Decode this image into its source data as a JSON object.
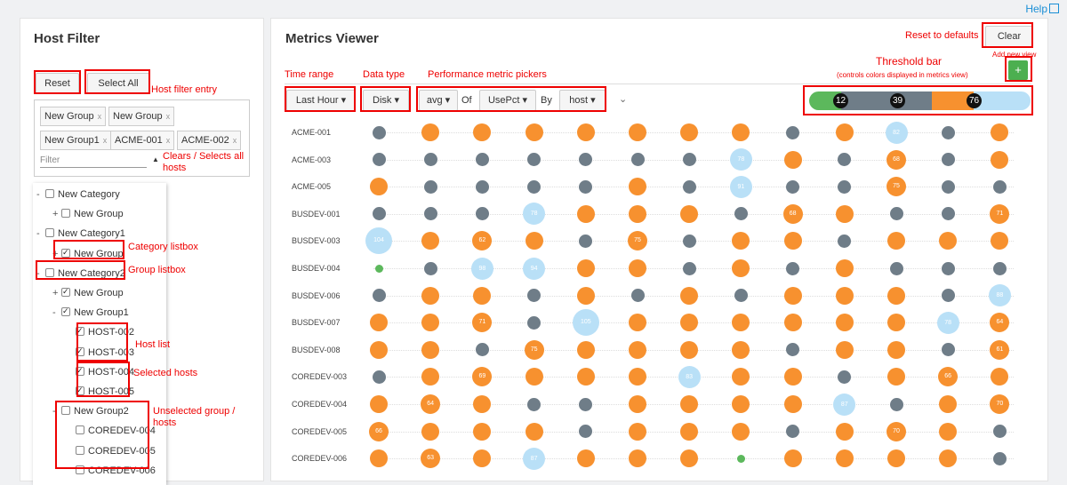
{
  "help_label": "Help",
  "host_filter": {
    "title": "Host Filter",
    "reset_label": "Reset",
    "select_all_label": "Select All",
    "tags": [
      "New Group",
      "New Group",
      "New Group1",
      "ACME-001",
      "ACME-002"
    ],
    "filter_placeholder": "Filter",
    "tree": [
      {
        "label": "New Category",
        "pm": "-",
        "checked": false
      },
      {
        "label": "New Group",
        "pm": "+",
        "checked": false
      },
      {
        "label": "New Category1",
        "pm": "-",
        "checked": false
      },
      {
        "label": "New Group",
        "pm": "+",
        "checked": true
      },
      {
        "label": "New Category2",
        "pm": "-",
        "checked": false
      },
      {
        "label": "New Group",
        "pm": "+",
        "checked": true
      },
      {
        "label": "New Group1",
        "pm": "-",
        "checked": true
      },
      {
        "label": "HOST-002",
        "pm": "",
        "checked": true
      },
      {
        "label": "HOST-003",
        "pm": "",
        "checked": true
      },
      {
        "label": "HOST-004",
        "pm": "",
        "checked": true
      },
      {
        "label": "HOST-005",
        "pm": "",
        "checked": true
      },
      {
        "label": "New Group2",
        "pm": "-",
        "checked": false
      },
      {
        "label": "COREDEV-004",
        "pm": "",
        "checked": false
      },
      {
        "label": "COREDEV-005",
        "pm": "",
        "checked": false
      },
      {
        "label": "COREDEV-006",
        "pm": "",
        "checked": false
      }
    ]
  },
  "metrics_viewer": {
    "title": "Metrics Viewer",
    "time_range": "Last Hour",
    "data_type": "Disk",
    "aggregate": "avg",
    "of_label": "Of",
    "metric": "UsePct",
    "by_label": "By",
    "group_by": "host",
    "clear_label": "Clear",
    "add_label": "+",
    "threshold_values": [
      "12",
      "39",
      "76"
    ],
    "colors": {
      "green": "#5cb85c",
      "gray": "#6f7d88",
      "orange": "#f7912f",
      "light_blue": "#b9e0f7"
    },
    "hosts": [
      "ACME-001",
      "ACME-003",
      "ACME-005",
      "BUSDEV-001",
      "BUSDEV-003",
      "BUSDEV-004",
      "BUSDEV-006",
      "BUSDEV-007",
      "BUSDEV-008",
      "COREDEV-003",
      "COREDEV-004",
      "COREDEV-005",
      "COREDEV-006"
    ],
    "cells": [
      [
        [
          "g",
          ""
        ],
        [
          "o",
          ""
        ],
        [
          "o",
          ""
        ],
        [
          "o",
          ""
        ],
        [
          "o",
          ""
        ],
        [
          "o",
          ""
        ],
        [
          "o",
          ""
        ],
        [
          "o",
          ""
        ],
        [
          "g",
          ""
        ],
        [
          "o",
          ""
        ],
        [
          "b",
          "82"
        ],
        [
          "g",
          ""
        ],
        [
          "o",
          ""
        ]
      ],
      [
        [
          "g",
          ""
        ],
        [
          "g",
          ""
        ],
        [
          "g",
          ""
        ],
        [
          "g",
          ""
        ],
        [
          "g",
          ""
        ],
        [
          "g",
          ""
        ],
        [
          "g",
          ""
        ],
        [
          "b",
          "78"
        ],
        [
          "o",
          ""
        ],
        [
          "g",
          ""
        ],
        [
          "o",
          "68"
        ],
        [
          "g",
          ""
        ],
        [
          "o",
          ""
        ]
      ],
      [
        [
          "o",
          ""
        ],
        [
          "g",
          ""
        ],
        [
          "g",
          ""
        ],
        [
          "g",
          ""
        ],
        [
          "g",
          ""
        ],
        [
          "o",
          ""
        ],
        [
          "g",
          ""
        ],
        [
          "b",
          "91"
        ],
        [
          "g",
          ""
        ],
        [
          "g",
          ""
        ],
        [
          "o",
          "75"
        ],
        [
          "g",
          ""
        ],
        [
          "g",
          ""
        ]
      ],
      [
        [
          "g",
          ""
        ],
        [
          "g",
          ""
        ],
        [
          "g",
          ""
        ],
        [
          "b",
          "78"
        ],
        [
          "o",
          ""
        ],
        [
          "o",
          ""
        ],
        [
          "o",
          ""
        ],
        [
          "g",
          ""
        ],
        [
          "o",
          "68"
        ],
        [
          "o",
          ""
        ],
        [
          "g",
          ""
        ],
        [
          "g",
          ""
        ],
        [
          "o",
          "71"
        ]
      ],
      [
        [
          "b",
          "104"
        ],
        [
          "o",
          ""
        ],
        [
          "o",
          "62"
        ],
        [
          "o",
          ""
        ],
        [
          "g",
          ""
        ],
        [
          "o",
          "75"
        ],
        [
          "g",
          ""
        ],
        [
          "o",
          ""
        ],
        [
          "o",
          ""
        ],
        [
          "g",
          ""
        ],
        [
          "o",
          ""
        ],
        [
          "o",
          ""
        ],
        [
          "o",
          ""
        ]
      ],
      [
        [
          "gr",
          ""
        ],
        [
          "g",
          ""
        ],
        [
          "b",
          "98"
        ],
        [
          "b",
          "94"
        ],
        [
          "o",
          ""
        ],
        [
          "o",
          ""
        ],
        [
          "g",
          ""
        ],
        [
          "o",
          ""
        ],
        [
          "g",
          ""
        ],
        [
          "o",
          ""
        ],
        [
          "g",
          ""
        ],
        [
          "g",
          ""
        ],
        [
          "g",
          ""
        ]
      ],
      [
        [
          "g",
          ""
        ],
        [
          "o",
          ""
        ],
        [
          "o",
          ""
        ],
        [
          "g",
          ""
        ],
        [
          "o",
          ""
        ],
        [
          "g",
          ""
        ],
        [
          "o",
          ""
        ],
        [
          "g",
          ""
        ],
        [
          "o",
          ""
        ],
        [
          "o",
          ""
        ],
        [
          "o",
          ""
        ],
        [
          "g",
          ""
        ],
        [
          "b",
          "88"
        ]
      ],
      [
        [
          "o",
          ""
        ],
        [
          "o",
          ""
        ],
        [
          "o",
          "71"
        ],
        [
          "g",
          ""
        ],
        [
          "b",
          "105"
        ],
        [
          "o",
          ""
        ],
        [
          "o",
          ""
        ],
        [
          "o",
          ""
        ],
        [
          "o",
          ""
        ],
        [
          "o",
          ""
        ],
        [
          "o",
          ""
        ],
        [
          "b",
          "78"
        ],
        [
          "o",
          "64"
        ]
      ],
      [
        [
          "o",
          ""
        ],
        [
          "o",
          ""
        ],
        [
          "g",
          ""
        ],
        [
          "o",
          "75"
        ],
        [
          "o",
          ""
        ],
        [
          "o",
          ""
        ],
        [
          "o",
          ""
        ],
        [
          "o",
          ""
        ],
        [
          "g",
          ""
        ],
        [
          "o",
          ""
        ],
        [
          "o",
          ""
        ],
        [
          "g",
          ""
        ],
        [
          "o",
          "61"
        ]
      ],
      [
        [
          "g",
          ""
        ],
        [
          "o",
          ""
        ],
        [
          "o",
          "69"
        ],
        [
          "o",
          ""
        ],
        [
          "o",
          ""
        ],
        [
          "o",
          ""
        ],
        [
          "b",
          "83"
        ],
        [
          "o",
          ""
        ],
        [
          "o",
          ""
        ],
        [
          "g",
          ""
        ],
        [
          "o",
          ""
        ],
        [
          "o",
          "66"
        ],
        [
          "o",
          ""
        ]
      ],
      [
        [
          "o",
          ""
        ],
        [
          "o",
          "64"
        ],
        [
          "o",
          ""
        ],
        [
          "g",
          ""
        ],
        [
          "g",
          ""
        ],
        [
          "o",
          ""
        ],
        [
          "o",
          ""
        ],
        [
          "o",
          ""
        ],
        [
          "o",
          ""
        ],
        [
          "b",
          "87"
        ],
        [
          "g",
          ""
        ],
        [
          "o",
          ""
        ],
        [
          "o",
          "70"
        ]
      ],
      [
        [
          "o",
          "66"
        ],
        [
          "o",
          ""
        ],
        [
          "o",
          ""
        ],
        [
          "o",
          ""
        ],
        [
          "g",
          ""
        ],
        [
          "o",
          ""
        ],
        [
          "o",
          ""
        ],
        [
          "o",
          ""
        ],
        [
          "g",
          ""
        ],
        [
          "o",
          ""
        ],
        [
          "o",
          "70"
        ],
        [
          "o",
          ""
        ],
        [
          "g",
          ""
        ]
      ],
      [
        [
          "o",
          ""
        ],
        [
          "o",
          "63"
        ],
        [
          "o",
          ""
        ],
        [
          "b",
          "87"
        ],
        [
          "o",
          ""
        ],
        [
          "o",
          ""
        ],
        [
          "o",
          ""
        ],
        [
          "gr",
          ""
        ],
        [
          "o",
          ""
        ],
        [
          "o",
          ""
        ],
        [
          "o",
          ""
        ],
        [
          "o",
          ""
        ],
        [
          "g",
          ""
        ]
      ]
    ]
  },
  "annotations": {
    "reset_defaults": "Reset to defaults",
    "add_new_view": "Add new view",
    "threshold_bar": "Threshold bar",
    "threshold_sub": "(controls colors displayed in metrics view)",
    "time_range": "Time range",
    "data_type": "Data type",
    "perf_pickers": "Performance metric pickers",
    "host_filter_entry": "Host filter entry",
    "clears_selects": "Clears / Selects all hosts",
    "category_listbox": "Category listbox",
    "group_listbox": "Group listbox",
    "host_list": "Host list",
    "selected_hosts": "Selected hosts",
    "unselected_group": "Unselected group / hosts"
  }
}
